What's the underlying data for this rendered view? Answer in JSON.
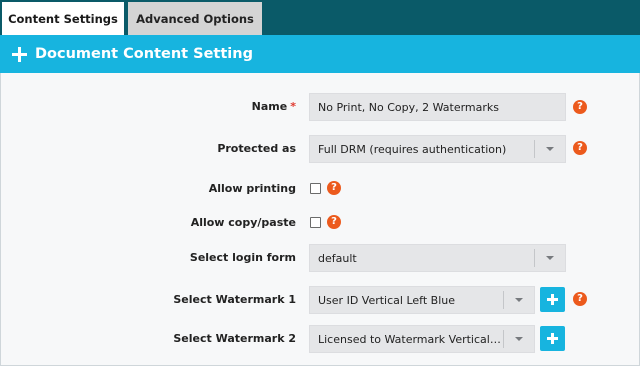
{
  "tabs": [
    {
      "label": "Content Settings",
      "active": true
    },
    {
      "label": "Advanced Options",
      "active": false
    }
  ],
  "section": {
    "title": "Document Content Setting",
    "icon": "plus-icon"
  },
  "form": {
    "name": {
      "label": "Name",
      "required_mark": "*",
      "value": "No Print, No Copy, 2 Watermarks"
    },
    "protected_as": {
      "label": "Protected as",
      "value": "Full DRM (requires authentication)"
    },
    "allow_printing": {
      "label": "Allow printing",
      "checked": false
    },
    "allow_copy_paste": {
      "label": "Allow copy/paste",
      "checked": false
    },
    "login_form": {
      "label": "Select login form",
      "value": "default"
    },
    "watermark1": {
      "label": "Select Watermark 1",
      "value": "User ID Vertical Left Blue"
    },
    "watermark2": {
      "label": "Select Watermark 2",
      "value": "Licensed to Watermark Vertical R..."
    }
  },
  "help_glyph": "?",
  "colors": {
    "tabbar_bg": "#0a5a68",
    "header_bg": "#17b4df",
    "help_icon": "#ec5a1d",
    "required": "#e0392f",
    "field_bg": "#e5e6e8"
  }
}
